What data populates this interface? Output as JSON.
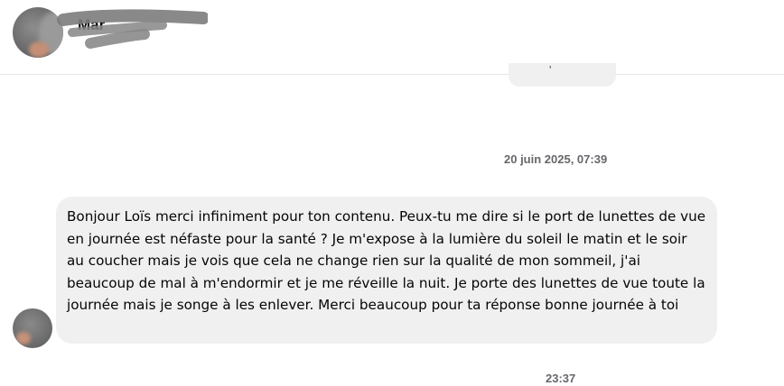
{
  "header": {
    "contact_name": "Mar"
  },
  "previous_message": {
    "partial_text": "'"
  },
  "messages": [
    {
      "timestamp": "20 juin 2025, 07:39",
      "text": "Bonjour Loïs merci infiniment pour ton contenu. Peux-tu me dire si le port de lunettes de vue en journée est néfaste pour la santé ? Je m'expose à la lumière du soleil le matin et le soir au coucher mais je vois que cela ne change rien sur la qualité de mon sommeil, j'ai beaucoup de mal à m'endormir et je me réveille la nuit. Je porte des lunettes de vue toute la journée mais je songe à les enlever. Merci beaucoup pour ta réponse bonne journée à toi"
    }
  ],
  "next_timestamp": "23:37",
  "colors": {
    "bubble_background": "#f0f0f0",
    "timestamp_text": "#65676b",
    "message_text": "#050505",
    "divider": "#e4e6eb"
  }
}
